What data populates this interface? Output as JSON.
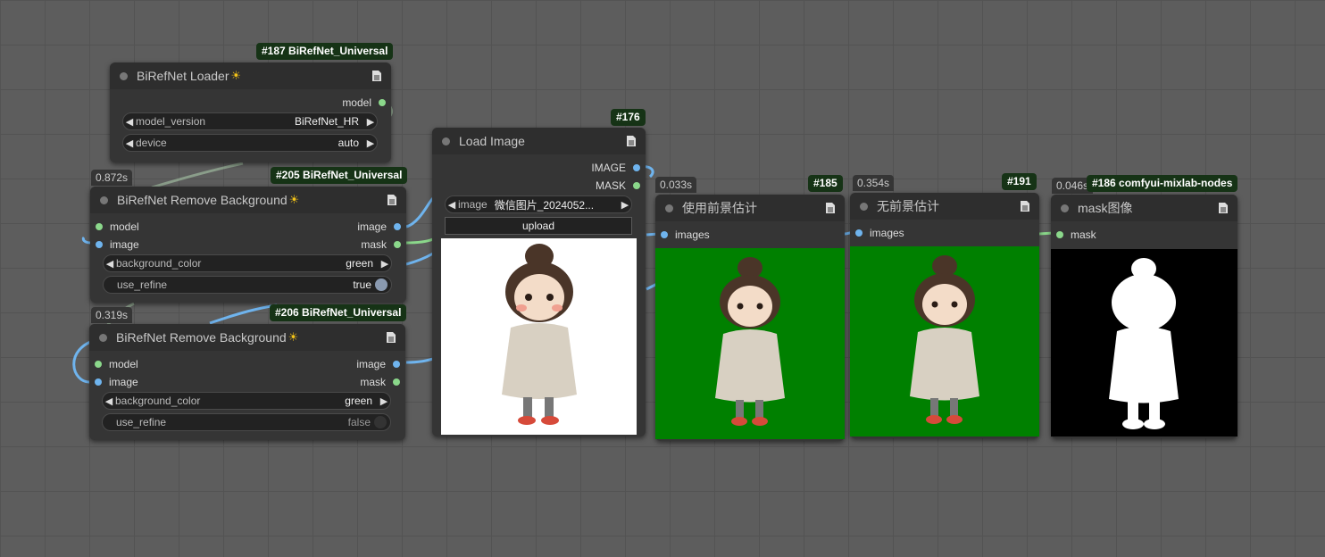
{
  "colors": {
    "green_bg": "#008000",
    "mask_bg": "#000000",
    "badge_bg": "#163316",
    "link_blue": "#6fb4ee",
    "link_green": "#8bd88b"
  },
  "icons": {
    "node_doc": "doc-icon",
    "loader_sun": "sun-icon"
  },
  "loader": {
    "badge": "#187 BiRefNet_Universal",
    "title": "BiRefNet Loader",
    "output_model": "model",
    "model_version_label": "model_version",
    "model_version_value": "BiRefNet_HR",
    "device_label": "device",
    "device_value": "auto"
  },
  "rb205": {
    "time": "0.872s",
    "badge": "#205 BiRefNet_Universal",
    "title": "BiRefNet Remove Background",
    "in_model": "model",
    "in_image": "image",
    "out_image": "image",
    "out_mask": "mask",
    "bg_label": "background_color",
    "bg_value": "green",
    "refine_label": "use_refine",
    "refine_value": "true"
  },
  "rb206": {
    "time": "0.319s",
    "badge": "#206 BiRefNet_Universal",
    "title": "BiRefNet Remove Background",
    "in_model": "model",
    "in_image": "image",
    "out_image": "image",
    "out_mask": "mask",
    "bg_label": "background_color",
    "bg_value": "green",
    "refine_label": "use_refine",
    "refine_value": "false"
  },
  "loadimage": {
    "badge": "#176",
    "title": "Load Image",
    "out_image": "IMAGE",
    "out_mask": "MASK",
    "image_label": "image",
    "image_value": "微信图片_2024052...",
    "upload_label": "upload"
  },
  "n185": {
    "time": "0.033s",
    "badge": "#185",
    "title": "使用前景估计",
    "in_images": "images"
  },
  "n191": {
    "time": "0.354s",
    "badge": "#191",
    "title": "无前景估计",
    "in_images": "images"
  },
  "n186": {
    "time": "0.046s",
    "badge": "#186 comfyui-mixlab-nodes",
    "title": "mask图像",
    "in_mask": "mask"
  }
}
